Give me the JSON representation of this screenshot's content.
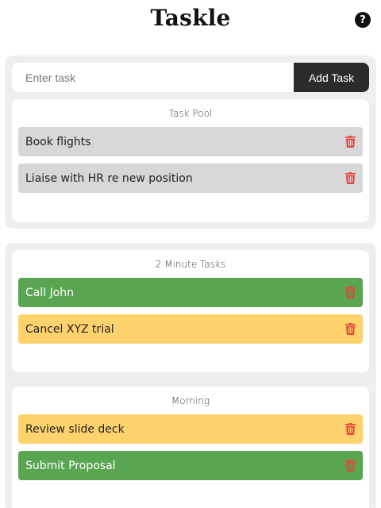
{
  "header": {
    "title": "Taskle",
    "help_icon": "question-circle-icon",
    "help_glyph": "?"
  },
  "input": {
    "placeholder": "Enter task",
    "value": "",
    "add_label": "Add Task"
  },
  "colors": {
    "accent_dark": "#2b2b2b",
    "task_grey": "#d7d7da",
    "task_green": "#5aa552",
    "task_yellow": "#fed26c",
    "delete_red": "#e8453c",
    "panel_bg": "#eeeeee"
  },
  "groups": [
    {
      "title": "Task Pool",
      "tasks": [
        {
          "label": "Book flights",
          "color": "grey",
          "delete_icon": "trash-icon"
        },
        {
          "label": "Liaise with HR re new position",
          "color": "grey",
          "delete_icon": "trash-icon"
        }
      ]
    },
    {
      "title": "2 Minute Tasks",
      "tasks": [
        {
          "label": "Call John",
          "color": "green",
          "delete_icon": "trash-icon"
        },
        {
          "label": "Cancel XYZ trial",
          "color": "yellow",
          "delete_icon": "trash-icon"
        }
      ]
    },
    {
      "title": "Morning",
      "tasks": [
        {
          "label": "Review slide deck",
          "color": "yellow",
          "delete_icon": "trash-icon"
        },
        {
          "label": "Submit Proposal",
          "color": "green",
          "delete_icon": "trash-icon"
        }
      ]
    }
  ]
}
